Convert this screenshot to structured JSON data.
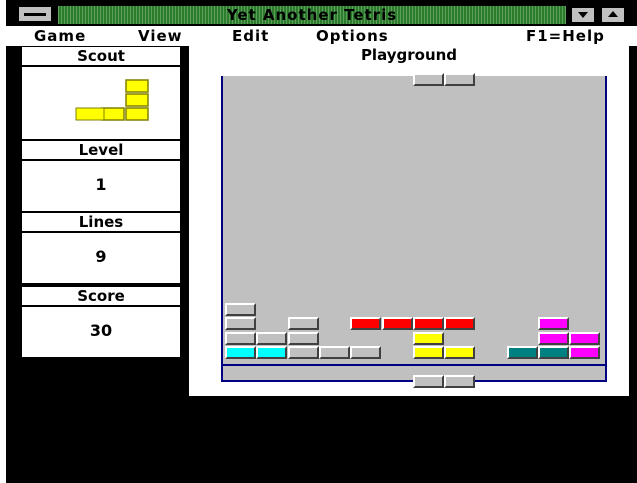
{
  "window": {
    "title": "Yet Another Tetris"
  },
  "menu": {
    "game": "Game",
    "view": "View",
    "edit": "Edit",
    "options": "Options",
    "help": "F1=Help"
  },
  "scout": {
    "title": "Scout",
    "piece_color": "#ffff00"
  },
  "level": {
    "title": "Level",
    "value": "1"
  },
  "lines": {
    "title": "Lines",
    "value": "9"
  },
  "score": {
    "title": "Score",
    "value": "30"
  },
  "playground": {
    "title": "Playground",
    "colors": {
      "gray": "#c0c0c0",
      "red": "#ff0000",
      "yellow": "#ffff00",
      "cyan": "#00ffff",
      "teal": "#008080",
      "magenta": "#ff00ff",
      "well_bg": "#c0c0c0",
      "well_border": "#000080"
    }
  }
}
